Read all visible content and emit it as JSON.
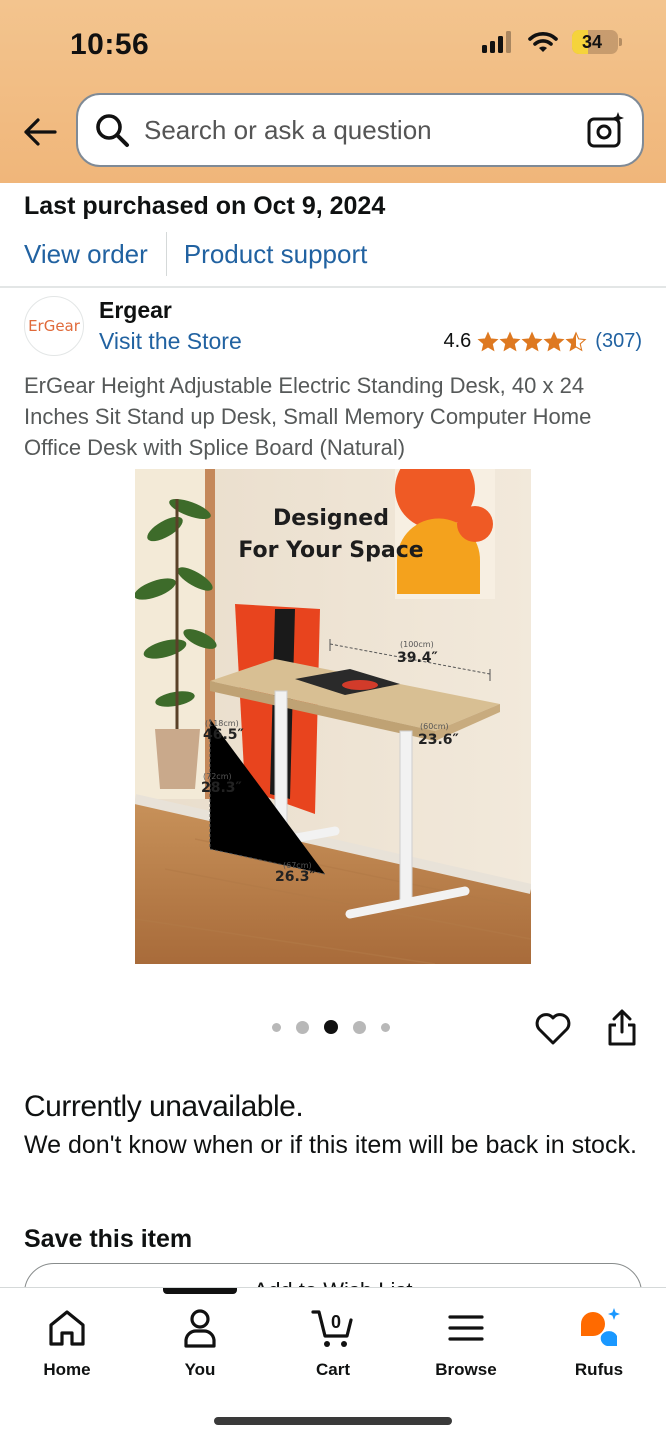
{
  "status_bar": {
    "time": "10:56",
    "battery": "34",
    "battery_level": 0.34
  },
  "search": {
    "placeholder": "Search or ask a question"
  },
  "purchase": {
    "last_purchased": "Last purchased on Oct 9, 2024",
    "view_order": "View order",
    "product_support": "Product support"
  },
  "store": {
    "logo_text": "ErGear",
    "brand": "Ergear",
    "visit_store": "Visit the Store",
    "rating": "4.6",
    "rating_stars": 4.5,
    "rating_count": "(307)",
    "star_color": "#de7921"
  },
  "product": {
    "title": "ErGear Height Adjustable Electric Standing Desk, 40 x 24 Inches Sit Stand up Desk, Small Memory Computer Home Office Desk with Splice Board (Natural)",
    "image": {
      "caption_line1": "Designed",
      "caption_line2": "For Your Space",
      "width_cm": "(100cm)",
      "width_in": "39.4″",
      "depth_cm": "(60cm)",
      "depth_in": "23.6″",
      "max_height_cm": "(118cm)",
      "max_height_in": "46.5″",
      "min_height_cm": "(72cm)",
      "min_height_in": "28.3″",
      "foot_cm": "(67cm)",
      "foot_in": "26.3″"
    },
    "carousel": {
      "count": 5,
      "active": 2
    }
  },
  "availability": {
    "heading": "Currently unavailable.",
    "description": "We don't know when or if this item will be back in stock."
  },
  "save": {
    "heading": "Save this item",
    "wishlist_button": "Add to Wish List"
  },
  "bottom_nav": {
    "home": "Home",
    "you": "You",
    "cart": "Cart",
    "cart_count": "0",
    "browse": "Browse",
    "rufus": "Rufus"
  },
  "colors": {
    "link": "#2162a1",
    "header": "#f3c48e",
    "rufus_orange": "#ff6a00",
    "rufus_blue": "#1a98ff"
  }
}
